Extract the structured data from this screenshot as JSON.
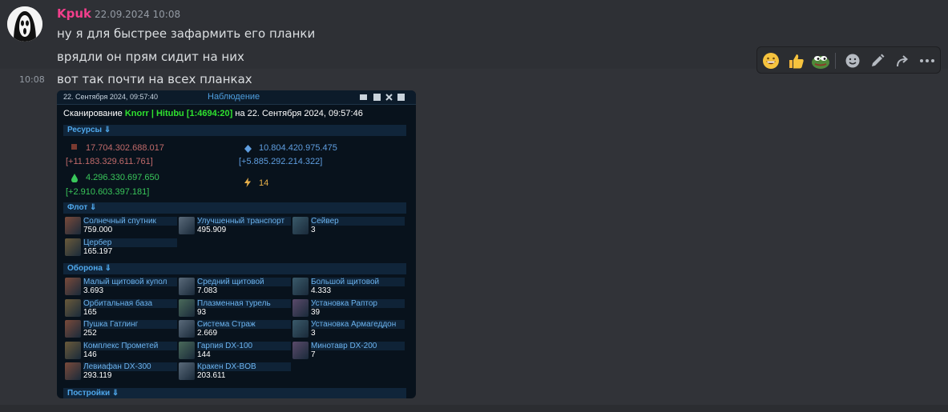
{
  "message_group": {
    "author": "Kpuk",
    "timestamp": "22.09.2024 10:08",
    "messages": [
      "ну я для быстрее зафармить его планки",
      "врядли он прям сидит на них",
      "вот так почти на всех планках"
    ],
    "last_message_time": "10:08"
  },
  "toolbar": {
    "buttons": [
      "grinning-face-reaction",
      "thumbs-up-reaction",
      "pepe-reaction",
      "add-reaction",
      "edit",
      "forward",
      "more"
    ]
  },
  "colors": {
    "background": "#313338",
    "author": "#f23f8c",
    "metal": "#c06a6a",
    "crystal": "#5f9ee0",
    "deuterium": "#39c65a",
    "energy": "#e8b04a"
  },
  "screenshot": {
    "date": "22. Сентября 2024, 09:57:40",
    "title": "Наблюдение",
    "scan_prefix": "Сканирование",
    "scan_target": "Knorr | Hitubu [1:4694:20]",
    "scan_suffix": "на 22. Сентября 2024, 09:57:46",
    "resources_header": "Ресурсы ⇓",
    "resources": {
      "metal": "17.704.302.688.017",
      "metal_rate": "[+11.183.329.611.761]",
      "crystal": "10.804.420.975.475",
      "crystal_rate": "[+5.885.292.214.322]",
      "deuterium": "4.296.330.697.650",
      "deuterium_rate": "[+2.910.603.397.181]",
      "energy": "14"
    },
    "fleet_header": "Флот ⇓",
    "fleet": [
      {
        "name": "Солнечный спутник",
        "count": "759.000"
      },
      {
        "name": "Улучшенный транспорт",
        "count": "495.909"
      },
      {
        "name": "Сейвер",
        "count": "3"
      },
      {
        "name": "Цербер",
        "count": "165.197"
      }
    ],
    "defense_header": "Оборона ⇓",
    "defense": [
      {
        "name": "Малый щитовой купол",
        "count": "3.693"
      },
      {
        "name": "Средний щитовой",
        "count": "7.083"
      },
      {
        "name": "Большой щитовой",
        "count": "4.333"
      },
      {
        "name": "Орбитальная база",
        "count": "165"
      },
      {
        "name": "Плазменная турель",
        "count": "93"
      },
      {
        "name": "Установка Раптор",
        "count": "39"
      },
      {
        "name": "Пушка Гатлинг",
        "count": "252"
      },
      {
        "name": "Система Страж",
        "count": "2.669"
      },
      {
        "name": "Установка Армагеддон",
        "count": "3"
      },
      {
        "name": "Комплекс Прометей",
        "count": "146"
      },
      {
        "name": "Гарпия DX-100",
        "count": "144"
      },
      {
        "name": "Минотавр DX-200",
        "count": "7"
      },
      {
        "name": "Левиафан DX-300",
        "count": "293.119"
      },
      {
        "name": "Кракен DX-BOB",
        "count": "203.611"
      }
    ],
    "buildings_header": "Постройки ⇓"
  }
}
